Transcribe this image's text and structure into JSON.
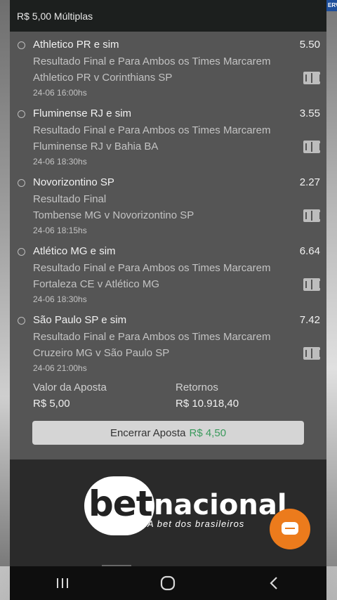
{
  "header": {
    "title": "R$ 5,00 Múltiplas"
  },
  "corner_badge": "ERV",
  "bets": [
    {
      "selection": "Athletico PR e sim",
      "odd": "5.50",
      "market": "Resultado Final e Para Ambos os Times Marcarem",
      "match": "Athletico PR v Corinthians SP",
      "time": "24-06 16:00hs"
    },
    {
      "selection": "Fluminense RJ e sim",
      "odd": "3.55",
      "market": "Resultado Final e Para Ambos os Times Marcarem",
      "match": "Fluminense RJ v Bahia BA",
      "time": "24-06 18:30hs"
    },
    {
      "selection": "Novorizontino SP",
      "odd": "2.27",
      "market": "Resultado Final",
      "match": "Tombense MG v Novorizontino SP",
      "time": "24-06 18:15hs"
    },
    {
      "selection": "Atlético MG e sim",
      "odd": "6.64",
      "market": "Resultado Final e Para Ambos os Times Marcarem",
      "match": "Fortaleza CE v Atlético MG",
      "time": "24-06 18:30hs"
    },
    {
      "selection": "São Paulo SP e sim",
      "odd": "7.42",
      "market": "Resultado Final e Para Ambos os Times Marcarem",
      "match": "Cruzeiro MG v São Paulo SP",
      "time": "24-06 21:00hs"
    }
  ],
  "summary": {
    "stake_label": "Valor da Aposta",
    "stake_value": "R$ 5,00",
    "returns_label": "Retornos",
    "returns_value": "R$ 10.918,40"
  },
  "cashout": {
    "label": "Encerrar Aposta",
    "amount": "R$ 4,50",
    "amount_color": "#3a9a5c"
  },
  "brand": {
    "logo_bet": "bet",
    "logo_nacional": "nacional",
    "tagline": "A bet dos brasileiros",
    "chat_color": "#ec7b1c"
  },
  "icons": {
    "match_icon": "soccer-field-icon",
    "chat": "chat-icon",
    "nav": [
      "recent-apps-icon",
      "home-icon",
      "back-icon"
    ]
  }
}
